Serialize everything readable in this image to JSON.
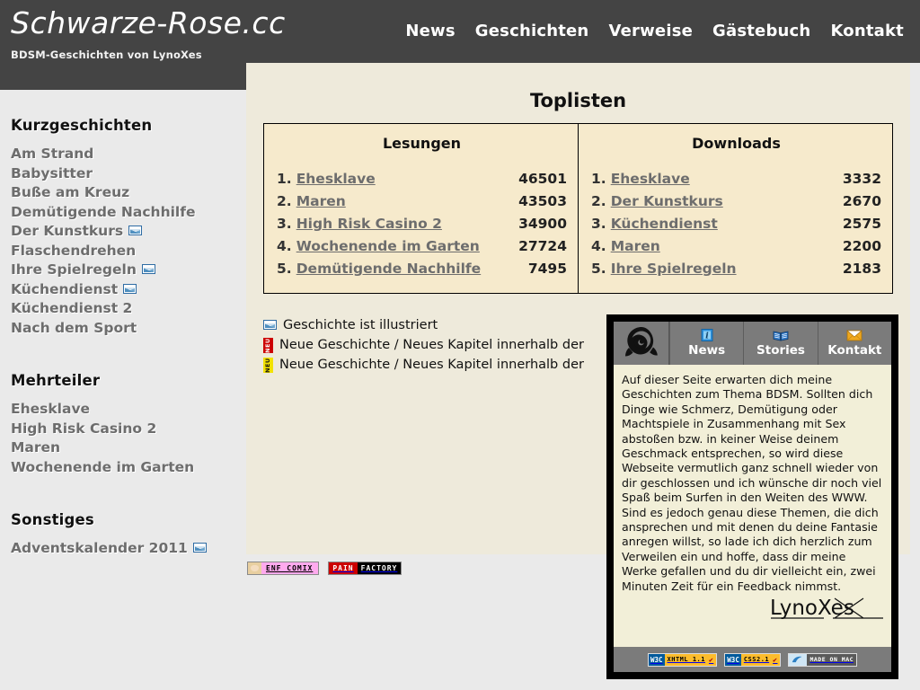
{
  "header": {
    "brand": "Schwarze-Rose.cc",
    "subtitle": "BDSM-Geschichten von LynoXes",
    "nav": [
      {
        "label": "News"
      },
      {
        "label": "Geschichten"
      },
      {
        "label": "Verweise"
      },
      {
        "label": "Gästebuch"
      },
      {
        "label": "Kontakt"
      }
    ]
  },
  "sidebar": {
    "sections": [
      {
        "heading": "Kurzgeschichten",
        "items": [
          {
            "label": "Am Strand",
            "illustrated": false
          },
          {
            "label": "Babysitter",
            "illustrated": false
          },
          {
            "label": "Buße am Kreuz",
            "illustrated": false
          },
          {
            "label": "Demütigende Nachhilfe",
            "illustrated": false
          },
          {
            "label": "Der Kunstkurs",
            "illustrated": true
          },
          {
            "label": "Flaschendrehen",
            "illustrated": false
          },
          {
            "label": "Ihre Spielregeln",
            "illustrated": true
          },
          {
            "label": "Küchendienst",
            "illustrated": true
          },
          {
            "label": "Küchendienst 2",
            "illustrated": false
          },
          {
            "label": "Nach dem Sport",
            "illustrated": false
          }
        ]
      },
      {
        "heading": "Mehrteiler",
        "items": [
          {
            "label": "Ehesklave",
            "illustrated": false
          },
          {
            "label": "High Risk Casino 2",
            "illustrated": false
          },
          {
            "label": "Maren",
            "illustrated": false
          },
          {
            "label": "Wochenende im Garten",
            "illustrated": false
          }
        ]
      },
      {
        "heading": "Sonstiges",
        "items": [
          {
            "label": "Adventskalender 2011",
            "illustrated": true
          }
        ]
      }
    ]
  },
  "main": {
    "title": "Toplisten",
    "lists": [
      {
        "title": "Lesungen",
        "rows": [
          {
            "rank": "1.",
            "name": "Ehesklave",
            "value": "46501"
          },
          {
            "rank": "2.",
            "name": "Maren",
            "value": "43503"
          },
          {
            "rank": "3.",
            "name": "High Risk Casino 2",
            "value": "34900"
          },
          {
            "rank": "4.",
            "name": "Wochenende im Garten",
            "value": "27724"
          },
          {
            "rank": "5.",
            "name": "Demütigende Nachhilfe",
            "value": "7495"
          }
        ]
      },
      {
        "title": "Downloads",
        "rows": [
          {
            "rank": "1.",
            "name": "Ehesklave",
            "value": "3332"
          },
          {
            "rank": "2.",
            "name": "Der Kunstkurs",
            "value": "2670"
          },
          {
            "rank": "3.",
            "name": "Küchendienst",
            "value": "2575"
          },
          {
            "rank": "4.",
            "name": "Maren",
            "value": "2200"
          },
          {
            "rank": "5.",
            "name": "Ihre Spielregeln",
            "value": "2183"
          }
        ]
      }
    ],
    "legend": [
      {
        "icon": "picture-icon",
        "text": "Geschichte ist illustriert"
      },
      {
        "icon": "neu-red-badge",
        "badge": "NEU",
        "text": "Neue Geschichte / Neues Kapitel innerhalb der"
      },
      {
        "icon": "neu-yellow-badge",
        "badge": "NEU",
        "text": "Neue Geschichte / Neues Kapitel innerhalb der"
      }
    ],
    "banners": [
      {
        "name": "enf-comix",
        "label": "ENF COMIX"
      },
      {
        "name": "pain-factory",
        "label_1": "PAIN",
        "label_2": "FACTORY"
      }
    ]
  },
  "overlay": {
    "logo_alt": "black-rose-logo",
    "tabs": [
      {
        "label": "News",
        "icon": "info-icon"
      },
      {
        "label": "Stories",
        "icon": "book-icon"
      },
      {
        "label": "Kontakt",
        "icon": "envelope-icon"
      }
    ],
    "body": "Auf dieser Seite erwarten dich meine Geschichten zum Thema BDSM. Sollten dich Dinge wie Schmerz, Demütigung oder Machtspiele in Zusammenhang mit Sex abstoßen bzw. in keiner Weise deinem Geschmack entsprechen, so wird diese Webseite vermutlich ganz schnell wieder von dir geschlossen und ich wünsche dir noch viel Spaß beim Surfen in den Weiten des WWW. Sind es jedoch genau diese Themen, die dich ansprechen und mit denen du deine Fantasie anregen willst, so lade ich dich herzlich zum Verweilen ein und hoffe, dass dir meine Werke gefallen und du dir vielleicht ein, zwei Minuten Zeit für ein Feedback nimmst.",
    "signature": "LynoXes",
    "footer_badges": [
      {
        "name": "w3c-xhtml-badge",
        "org": "W3C",
        "label": "XHTML 1.1",
        "check": "✔"
      },
      {
        "name": "w3c-css-badge",
        "org": "W3C",
        "label": "CSS2.1",
        "check": "✔"
      },
      {
        "name": "made-on-mac-badge",
        "label": "MADE ON MAC"
      }
    ]
  },
  "colors": {
    "header_bg": "#444444",
    "sidebar_bg": "#eaeaea",
    "content_bg": "#eeeadb",
    "table_bg": "#f6eacc",
    "link": "#6d6d6d",
    "overlay_bg": "#f2efd8",
    "overlay_chrome": "#7b7b7b"
  }
}
